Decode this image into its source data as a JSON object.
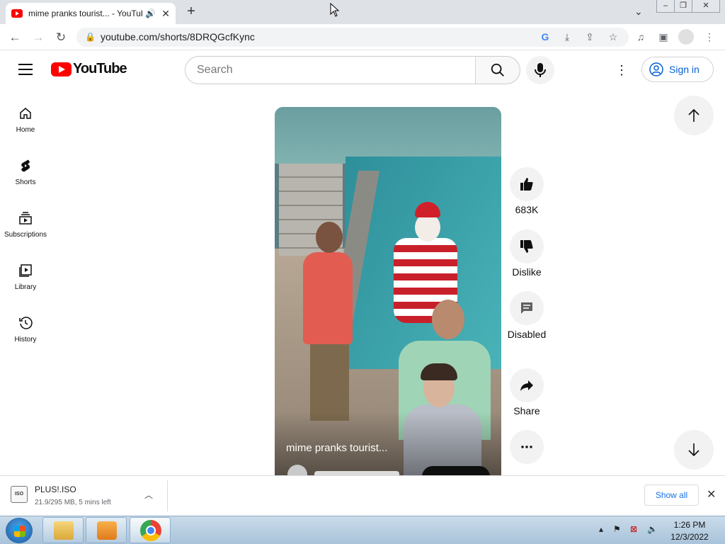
{
  "browser": {
    "tab_title": "mime pranks tourist... - YouTube",
    "url": "youtube.com/shorts/8DRQGcfKync"
  },
  "youtube": {
    "logo_text": "YouTube",
    "search_placeholder": "Search",
    "signin_label": "Sign in"
  },
  "sidebar": {
    "items": [
      {
        "label": "Home",
        "icon": "home-icon"
      },
      {
        "label": "Shorts",
        "icon": "shorts-icon"
      },
      {
        "label": "Subscriptions",
        "icon": "subscriptions-icon"
      },
      {
        "label": "Library",
        "icon": "library-icon"
      },
      {
        "label": "History",
        "icon": "history-icon"
      }
    ]
  },
  "video": {
    "title": "mime pranks tourist..."
  },
  "actions": {
    "like_count": "683K",
    "dislike_label": "Dislike",
    "comments_label": "Disabled",
    "share_label": "Share"
  },
  "download": {
    "file_name": "PLUS!.ISO",
    "status": "21.9/295 MB, 5 mins left",
    "icon_text": "ISO",
    "show_all": "Show all"
  },
  "taskbar": {
    "time": "1:26 PM",
    "date": "12/3/2022"
  },
  "colors": {
    "youtube_red": "#ff0000",
    "link_blue": "#065fd4"
  }
}
